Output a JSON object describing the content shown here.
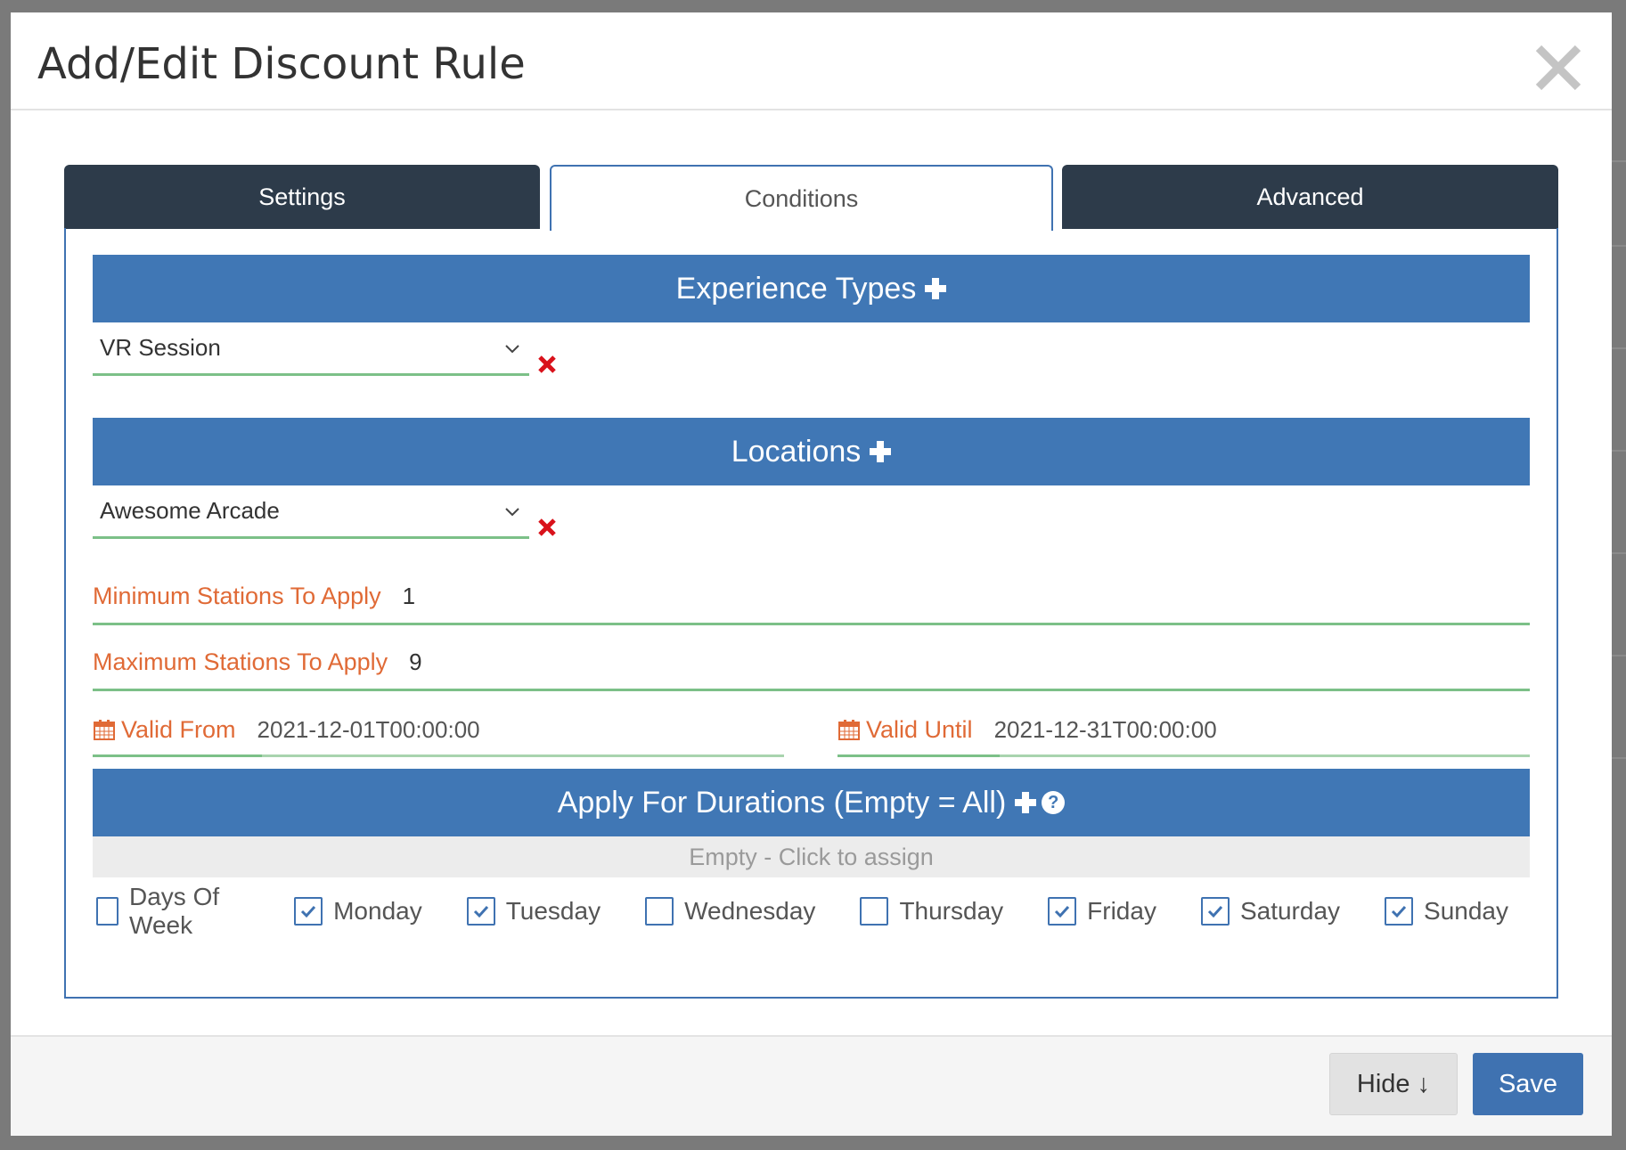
{
  "modal": {
    "title": "Add/Edit Discount Rule",
    "close_icon": "close-icon"
  },
  "tabs": [
    {
      "label": "Settings",
      "active": false
    },
    {
      "label": "Conditions",
      "active": true
    },
    {
      "label": "Advanced",
      "active": false
    }
  ],
  "experience_types": {
    "heading": "Experience Types",
    "selected": "VR Session"
  },
  "locations": {
    "heading": "Locations",
    "selected": "Awesome Arcade"
  },
  "min_stations": {
    "label": "Minimum Stations To Apply",
    "value": "1"
  },
  "max_stations": {
    "label": "Maximum Stations To Apply",
    "value": "9"
  },
  "valid_from": {
    "label": "Valid From",
    "value": "2021-12-01T00:00:00"
  },
  "valid_until": {
    "label": "Valid Until",
    "value": "2021-12-31T00:00:00"
  },
  "durations": {
    "heading": "Apply For Durations (Empty = All)",
    "empty_text": "Empty - Click to assign"
  },
  "days": [
    {
      "label": "Days Of Week",
      "checked": false
    },
    {
      "label": "Monday",
      "checked": true
    },
    {
      "label": "Tuesday",
      "checked": true
    },
    {
      "label": "Wednesday",
      "checked": false
    },
    {
      "label": "Thursday",
      "checked": false
    },
    {
      "label": "Friday",
      "checked": true
    },
    {
      "label": "Saturday",
      "checked": true
    },
    {
      "label": "Sunday",
      "checked": true
    }
  ],
  "footer": {
    "hide_label": "Hide ↓",
    "save_label": "Save"
  },
  "colors": {
    "section_blue": "#4077b5",
    "tab_dark": "#2d3b4a",
    "label_orange": "#e06a36",
    "underline_green": "#7cc088",
    "remove_red": "#d9121b"
  }
}
